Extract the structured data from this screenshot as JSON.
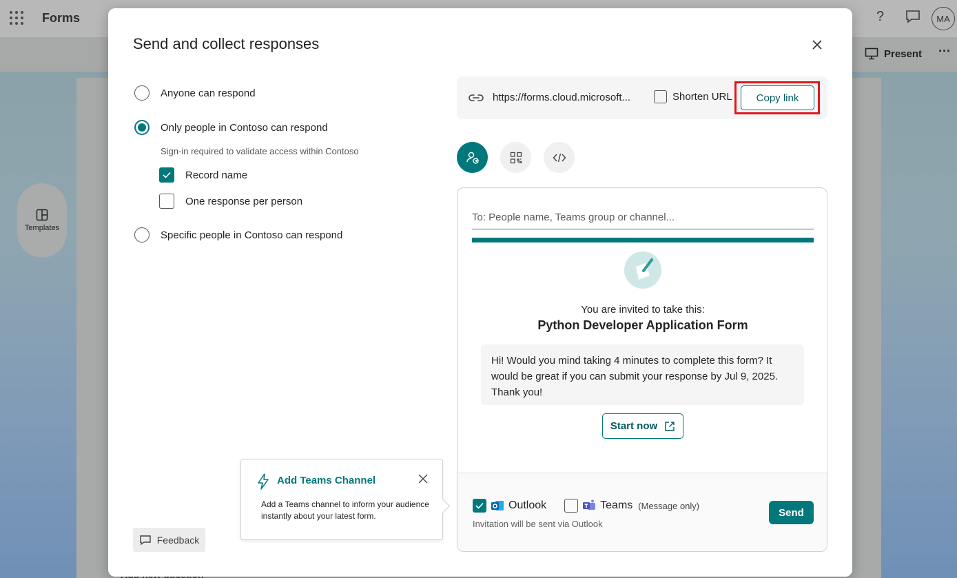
{
  "app": {
    "title": "Forms",
    "avatar_initials": "MA",
    "present_label": "Present",
    "templates_label": "Templates",
    "bg_add_question": "Add new question"
  },
  "dialog": {
    "title": "Send and collect responses",
    "options": {
      "anyone": "Anyone can respond",
      "org_only": "Only people in Contoso can respond",
      "org_only_sub": "Sign-in required to validate access within Contoso",
      "record_name": "Record name",
      "one_response": "One response per person",
      "specific": "Specific people in Contoso can respond"
    },
    "selected_option": "org_only",
    "record_name_checked": true,
    "one_response_checked": false,
    "link": {
      "url": "https://forms.cloud.microsoft...",
      "shorten_label": "Shorten URL",
      "shorten_checked": false,
      "copy_label": "Copy link"
    },
    "tabs": [
      "invite-people",
      "qr-code",
      "embed-code"
    ],
    "active_tab": "invite-people",
    "invite": {
      "to_placeholder": "To: People name, Teams group or channel...",
      "line1": "You are invited to take this:",
      "form_name": "Python Developer Application Form",
      "message": "Hi! Would you mind taking 4 minutes to complete this form? It would be great if you can submit your response by Jul 9, 2025. Thank you!",
      "start_label": "Start now",
      "outlook_label": "Outlook",
      "outlook_checked": true,
      "teams_label": "Teams",
      "teams_note": "(Message only)",
      "teams_checked": false,
      "via_text": "Invitation will be sent via Outlook",
      "send_label": "Send"
    },
    "teams_popup": {
      "title": "Add Teams Channel",
      "body": "Add a Teams channel to inform your audience instantly about your latest form."
    },
    "feedback_label": "Feedback"
  },
  "colors": {
    "accent": "#03787c",
    "highlight": "#e0161e"
  }
}
